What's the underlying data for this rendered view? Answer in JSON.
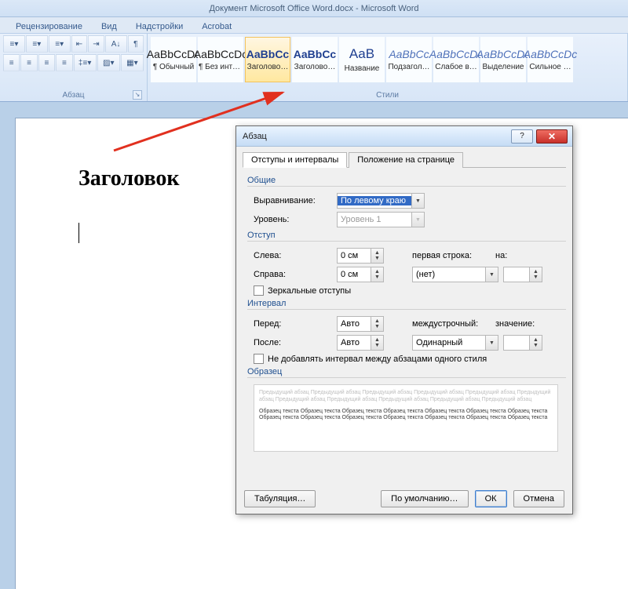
{
  "window": {
    "title": "Документ Microsoft Office Word.docx - Microsoft Word"
  },
  "ribbon": {
    "tabs": [
      "Рецензирование",
      "Вид",
      "Надстройки",
      "Acrobat"
    ],
    "groups": {
      "paragraph": "Абзац",
      "styles": "Стили"
    },
    "styles": [
      {
        "preview": "AaBbCcDc",
        "label": "¶ Обычный",
        "cls": ""
      },
      {
        "preview": "AaBbCcDc",
        "label": "¶ Без инте…",
        "cls": ""
      },
      {
        "preview": "AaBbCc",
        "label": "Заголово…",
        "cls": "heading",
        "selected": true
      },
      {
        "preview": "AaBbCc",
        "label": "Заголово…",
        "cls": "heading"
      },
      {
        "preview": "AaB",
        "label": "Название",
        "cls": "title"
      },
      {
        "preview": "AaBbCc",
        "label": "Подзагол…",
        "cls": "italic"
      },
      {
        "preview": "AaBbCcDc",
        "label": "Слабое в…",
        "cls": "italic"
      },
      {
        "preview": "AaBbCcDc",
        "label": "Выделение",
        "cls": "italic"
      },
      {
        "preview": "AaBbCcDc",
        "label": "Сильное …",
        "cls": "italic"
      }
    ]
  },
  "document": {
    "heading": "Заголовок"
  },
  "dialog": {
    "title": "Абзац",
    "tabs": {
      "indents": "Отступы и интервалы",
      "position": "Положение на странице"
    },
    "sections": {
      "general": "Общие",
      "indent": "Отступ",
      "spacing": "Интервал",
      "sample": "Образец"
    },
    "labels": {
      "alignment": "Выравнивание:",
      "level": "Уровень:",
      "left": "Слева:",
      "right": "Справа:",
      "firstline": "первая строка:",
      "by": "на:",
      "mirror": "Зеркальные отступы",
      "before": "Перед:",
      "after": "После:",
      "linesp": "междустрочный:",
      "value": "значение:",
      "nosame": "Не добавлять интервал между абзацами одного стиля"
    },
    "values": {
      "alignment": "По левому краю",
      "level": "Уровень 1",
      "left": "0 см",
      "right": "0 см",
      "firstline": "(нет)",
      "by": "",
      "before": "Авто",
      "after": "Авто",
      "linesp": "Одинарный",
      "value": ""
    },
    "sample_grey": "Предыдущий абзац Предыдущий абзац Предыдущий абзац Предыдущий абзац Предыдущий абзац Предыдущий абзац Предыдущий абзац Предыдущий абзац Предыдущий абзац Предыдущий абзац Предыдущий абзац",
    "sample_bold": "Образец текста Образец текста Образец текста Образец текста Образец текста Образец текста Образец текста Образец текста Образец текста Образец текста Образец текста Образец текста Образец текста Образец текста",
    "buttons": {
      "tabs": "Табуляция…",
      "default": "По умолчанию…",
      "ok": "ОК",
      "cancel": "Отмена"
    }
  }
}
